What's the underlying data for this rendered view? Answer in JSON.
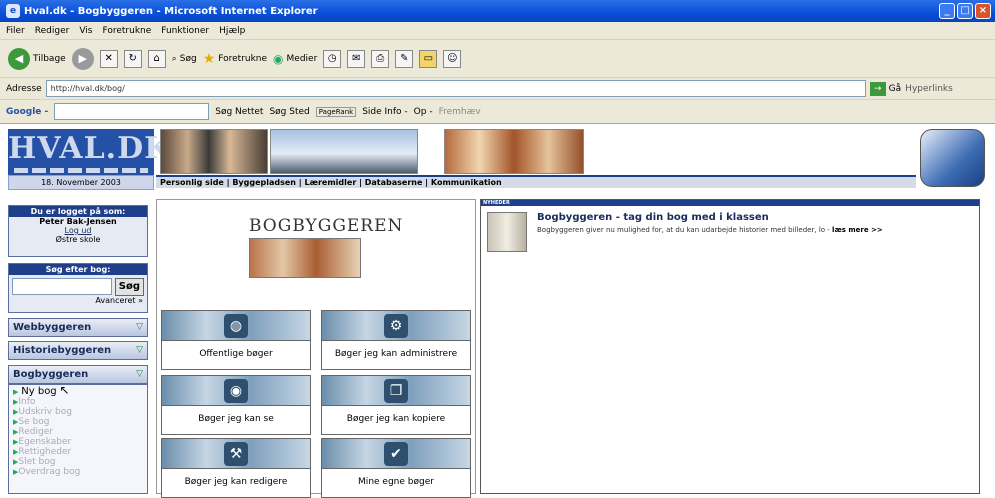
{
  "window": {
    "title": "Hval.dk - Bogbyggeren - Microsoft Internet Explorer",
    "buttons": [
      "_",
      "□",
      "×"
    ]
  },
  "menu": [
    "Filer",
    "Rediger",
    "Vis",
    "Foretrukne",
    "Funktioner",
    "Hjælp"
  ],
  "toolbar": {
    "back": "Tilbage",
    "search": "Søg",
    "favorites": "Foretrukne",
    "media": "Medier"
  },
  "address": {
    "label": "Adresse",
    "url": "http://hval.dk/bog/",
    "go": "Gå",
    "links": "Hyperlinks"
  },
  "google": {
    "label": "Google -",
    "search_web": "Søg Nettet",
    "search_site": "Søg Sted",
    "pagerank": "PageRank",
    "page_info": "Side Info -",
    "up": "Op -",
    "highlight": "Fremhæv"
  },
  "site": {
    "logo": "HVAL.DK",
    "date": "18. November 2003",
    "nav": "Personlig side | Byggepladsen | Læremidler | Databaserne | Kommunikation",
    "login": {
      "head": "Du er logget på som:",
      "name": "Peter Bak-Jensen",
      "logout": "Log ud",
      "school": "Østre skole"
    },
    "search": {
      "head": "Søg efter bog:",
      "button": "Søg",
      "advanced": "Avanceret »"
    },
    "sections": {
      "web": "Webbyggeren",
      "history": "Historiebyggeren",
      "book": "Bogbyggeren"
    },
    "book_menu": {
      "new": "Ny bog",
      "items": [
        "Info",
        "Udskriv bog",
        "Se bog",
        "Rediger",
        "Egenskaber",
        "Rettigheder",
        "Slet bog",
        "Overdrag bog"
      ]
    },
    "main": {
      "title": "BOGBYGGEREN",
      "tiles": [
        "Offentlige bøger",
        "Bøger jeg kan administrere",
        "Bøger jeg kan se",
        "Bøger jeg kan kopiere",
        "Bøger jeg kan redigere",
        "Mine egne bøger"
      ]
    },
    "news": {
      "head": "NYHEDER",
      "title": "Bogbyggeren - tag din bog med i klassen",
      "text": "Bogbyggeren giver nu mulighed for, at du kan udarbejde historier med billeder, lo -",
      "more": "læs mere >>"
    }
  }
}
